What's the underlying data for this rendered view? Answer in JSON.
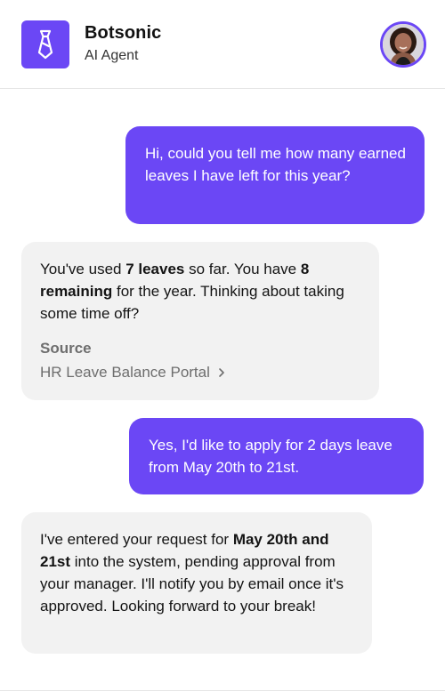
{
  "header": {
    "title": "Botsonic",
    "subtitle": "AI Agent",
    "logo_icon": "necktie-icon",
    "accent_color": "#6b47f5"
  },
  "messages": [
    {
      "role": "user",
      "text": "Hi, could you tell me how many earned leaves I have left for this year?"
    },
    {
      "role": "bot",
      "parts": [
        "You've used ",
        "7 leaves",
        " so far. You have ",
        "8 remaining",
        " for the year. Thinking about taking some time off?"
      ],
      "source_label": "Source",
      "source_link": "HR Leave Balance Portal"
    },
    {
      "role": "user",
      "text": "Yes, I'd like to apply for 2 days leave from May 20th to 21st."
    },
    {
      "role": "bot",
      "parts": [
        "I've entered your request for ",
        "May 20th and 21st",
        " into the system, pending approval from your manager. I'll notify you by email once it's approved. Looking forward to your break!"
      ]
    }
  ]
}
